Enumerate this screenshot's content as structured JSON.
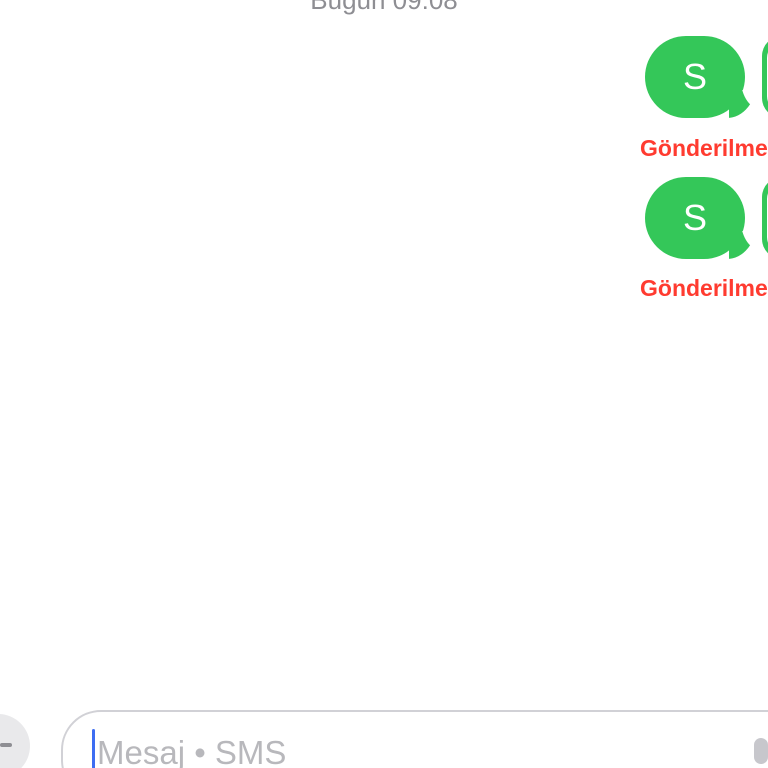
{
  "conversation": {
    "timestamp": "Bugün 09:08"
  },
  "messages": [
    {
      "text": "S",
      "status": "Gönderilmedi"
    },
    {
      "text": "S",
      "status": "Gönderilmedi"
    }
  ],
  "composer": {
    "placeholder": "Mesaj • SMS"
  },
  "colors": {
    "bubble": "#34c759",
    "error_text": "#ff3b30",
    "cursor": "#3d6df2"
  },
  "icons": {
    "attach": "plus-icon",
    "dictation": "microphone-icon"
  }
}
